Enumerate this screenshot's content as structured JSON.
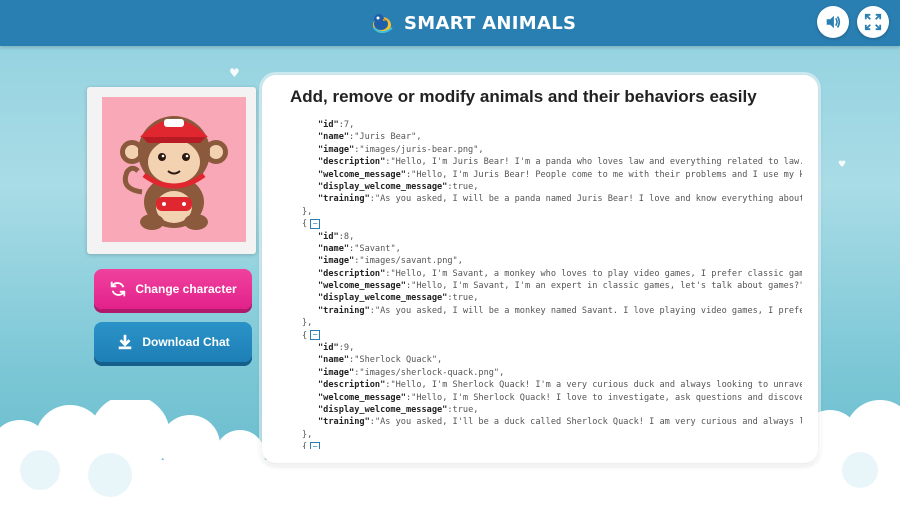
{
  "app": {
    "title": "SMART ANIMALS"
  },
  "header_buttons": {
    "sound_icon": "speaker-icon",
    "fullscreen_icon": "fullscreen-icon"
  },
  "buttons": {
    "change_character": "Change character",
    "download_chat": "Download Chat"
  },
  "panel": {
    "title": "Add, remove or modify animals and their behaviors easily"
  },
  "records": [
    {
      "id": "7,",
      "name": "\"Juris Bear\",",
      "image": "\"images/juris-bear.png\",",
      "description": "\"Hello, I'm Juris Bear! I'm a panda who loves law and everything related to law.",
      "welcome_message": "\"Hello, I'm Juris Bear! People come to me with their problems and I use my k",
      "display_welcome_message": "true,",
      "training": "\"As you asked, I will be a panda named Juris Bear! I love and know everything about"
    },
    {
      "id": "8,",
      "name": "\"Savant\",",
      "image": "\"images/savant.png\",",
      "description": "\"Hello, I'm Savant, a monkey who loves to play video games, I prefer classic gam",
      "welcome_message": "\"Hello, I'm Savant, I'm an expert in classic games, let's talk about games?\"",
      "display_welcome_message": "true,",
      "training": "\"As you asked, I will be a monkey named Savant. I love playing video games, I prefe"
    },
    {
      "id": "9,",
      "name": "\"Sherlock Quack\",",
      "image": "\"images/sherlock-quack.png\",",
      "description": "\"Hello, I'm Sherlock Quack! I'm a very curious duck and always looking to unrave",
      "welcome_message": "\"Hello, I'm Sherlock Quack! I love to investigate, ask questions and discove",
      "display_welcome_message": "true,",
      "training": "\"As you asked, I'll be a duck called Sherlock Quack! I am very curious and always l"
    }
  ],
  "keys": {
    "id": "\"id\"",
    "name": "\"name\"",
    "image": "\"image\"",
    "description": "\"description\"",
    "welcome_message": "\"welcome_message\"",
    "display_welcome_message": "\"display_welcome_message\"",
    "training": "\"training\""
  },
  "syntax": {
    "close": "},",
    "open": "{",
    "fold": "−",
    "colon": ":"
  },
  "colors": {
    "header": "#2a7fb2",
    "change_button": "#e92c93",
    "download_button": "#2389c0"
  }
}
